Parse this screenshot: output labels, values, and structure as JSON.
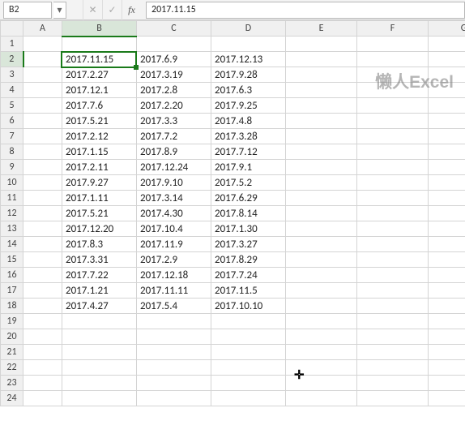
{
  "formula_bar": {
    "cell_ref": "B2",
    "cancel_icon": "✕",
    "confirm_icon": "✓",
    "fx_label": "fx",
    "value": "2017.11.15"
  },
  "columns": [
    "A",
    "B",
    "C",
    "D",
    "E",
    "F",
    "G"
  ],
  "row_headers": [
    1,
    2,
    3,
    4,
    5,
    6,
    7,
    8,
    9,
    10,
    11,
    12,
    13,
    14,
    15,
    16,
    17,
    18,
    19,
    20,
    21,
    22,
    23,
    24
  ],
  "active_cell": {
    "col": "B",
    "row": 2
  },
  "watermark": "懒人Excel",
  "chart_data": {
    "type": "table",
    "columns": [
      "B",
      "C",
      "D"
    ],
    "rows": [
      {
        "row": 2,
        "B": "2017.11.15",
        "C": "2017.6.9",
        "D": "2017.12.13"
      },
      {
        "row": 3,
        "B": "2017.2.27",
        "C": "2017.3.19",
        "D": "2017.9.28"
      },
      {
        "row": 4,
        "B": "2017.12.1",
        "C": "2017.2.8",
        "D": "2017.6.3"
      },
      {
        "row": 5,
        "B": "2017.7.6",
        "C": "2017.2.20",
        "D": "2017.9.25"
      },
      {
        "row": 6,
        "B": "2017.5.21",
        "C": "2017.3.3",
        "D": "2017.4.8"
      },
      {
        "row": 7,
        "B": "2017.2.12",
        "C": "2017.7.2",
        "D": "2017.3.28"
      },
      {
        "row": 8,
        "B": "2017.1.15",
        "C": "2017.8.9",
        "D": "2017.7.12"
      },
      {
        "row": 9,
        "B": "2017.2.11",
        "C": "2017.12.24",
        "D": "2017.9.1"
      },
      {
        "row": 10,
        "B": "2017.9.27",
        "C": "2017.9.10",
        "D": "2017.5.2"
      },
      {
        "row": 11,
        "B": "2017.1.11",
        "C": "2017.3.14",
        "D": "2017.6.29"
      },
      {
        "row": 12,
        "B": "2017.5.21",
        "C": "2017.4.30",
        "D": "2017.8.14"
      },
      {
        "row": 13,
        "B": "2017.12.20",
        "C": "2017.10.4",
        "D": "2017.1.30"
      },
      {
        "row": 14,
        "B": "2017.8.3",
        "C": "2017.11.9",
        "D": "2017.3.27"
      },
      {
        "row": 15,
        "B": "2017.3.31",
        "C": "2017.2.9",
        "D": "2017.8.29"
      },
      {
        "row": 16,
        "B": "2017.7.22",
        "C": "2017.12.18",
        "D": "2017.7.24"
      },
      {
        "row": 17,
        "B": "2017.1.21",
        "C": "2017.11.11",
        "D": "2017.11.5"
      },
      {
        "row": 18,
        "B": "2017.4.27",
        "C": "2017.5.4",
        "D": "2017.10.10"
      }
    ]
  }
}
